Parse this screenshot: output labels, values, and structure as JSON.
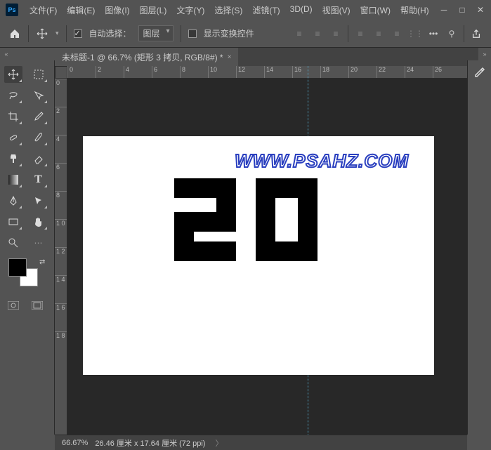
{
  "app": {
    "logo": "Ps"
  },
  "menu": [
    "文件(F)",
    "编辑(E)",
    "图像(I)",
    "图层(L)",
    "文字(Y)",
    "选择(S)",
    "滤镜(T)",
    "3D(D)",
    "视图(V)",
    "窗口(W)",
    "帮助(H)"
  ],
  "options": {
    "auto_select_label": "自动选择：",
    "layer_dropdown": "图层",
    "show_transform_label": "显示变换控件",
    "auto_select_checked": true,
    "show_transform_checked": false
  },
  "tab": {
    "title": "未标题-1 @ 66.7% (矩形 3 拷贝, RGB/8#) *"
  },
  "ruler_h": [
    "0",
    "2",
    "4",
    "6",
    "8",
    "10",
    "12",
    "14",
    "16",
    "18",
    "20",
    "22",
    "24",
    "26"
  ],
  "ruler_v": [
    "0",
    "2",
    "4",
    "6",
    "8",
    "1 0",
    "1 2",
    "1 4",
    "1 6",
    "1 8"
  ],
  "canvas": {
    "watermark": "WWW.PSAHZ.COM",
    "digits": [
      "2",
      "0"
    ]
  },
  "status": {
    "zoom": "66.67%",
    "dims": "26.46 厘米 x 17.64 厘米 (72 ppi)"
  },
  "tools": [
    "move-tool",
    "artboard-tool",
    "lasso-tool",
    "magic-wand-tool",
    "crop-tool",
    "eyedropper-tool",
    "healing-tool",
    "brush-tool",
    "clone-tool",
    "eraser-tool",
    "gradient-tool",
    "blur-tool",
    "dodge-tool",
    "pen-tool",
    "type-tool",
    "path-tool",
    "rectangle-tool",
    "hand-tool",
    "zoom-tool"
  ],
  "right_rail": [
    "edit-toolbar-icon"
  ],
  "colors": {
    "fg": "#000000",
    "bg": "#ffffff"
  }
}
